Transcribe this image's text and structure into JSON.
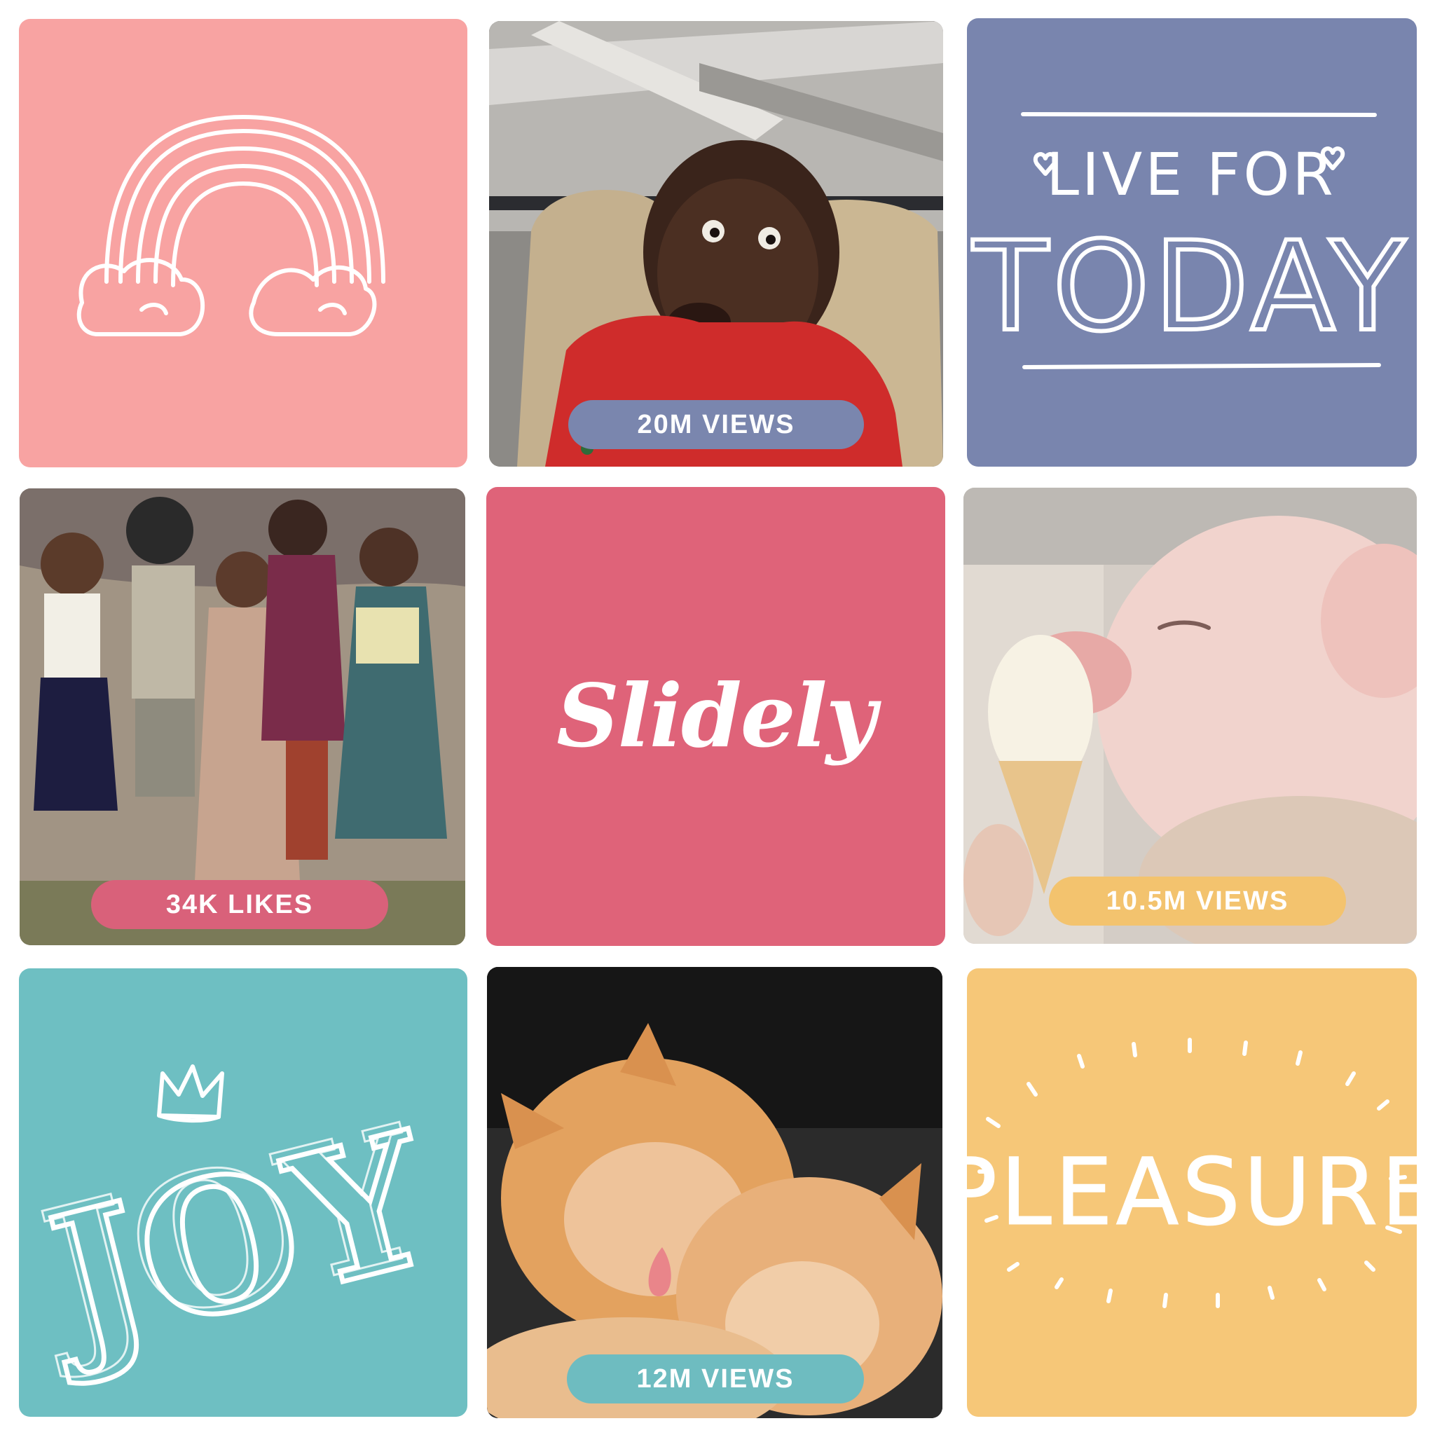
{
  "colors": {
    "pink_light": "#F8A3A2",
    "slate_blue": "#7985AE",
    "rose": "#DF6379",
    "teal": "#6EBFC2",
    "yellow": "#F6C778",
    "pill_blue": "#7A86AE",
    "pill_rose": "#D9617A",
    "pill_yellow": "#F3C36E",
    "pill_teal": "#6EBCC0"
  },
  "tiles": {
    "rainbow": {
      "icon": "rainbow-icon"
    },
    "scared_kid": {
      "badge": "20M VIEWS"
    },
    "live_for_today": {
      "line1": "LIVE FOR",
      "line2": "TODAY"
    },
    "children": {
      "badge": "34K LIKES"
    },
    "logo": {
      "text": "Slidely"
    },
    "pig": {
      "badge": "10.5M VIEWS"
    },
    "joy": {
      "text": "JOY",
      "icon": "crown-icon"
    },
    "cats": {
      "badge": "12M VIEWS"
    },
    "pleasure": {
      "text": "PLEASURE"
    }
  }
}
